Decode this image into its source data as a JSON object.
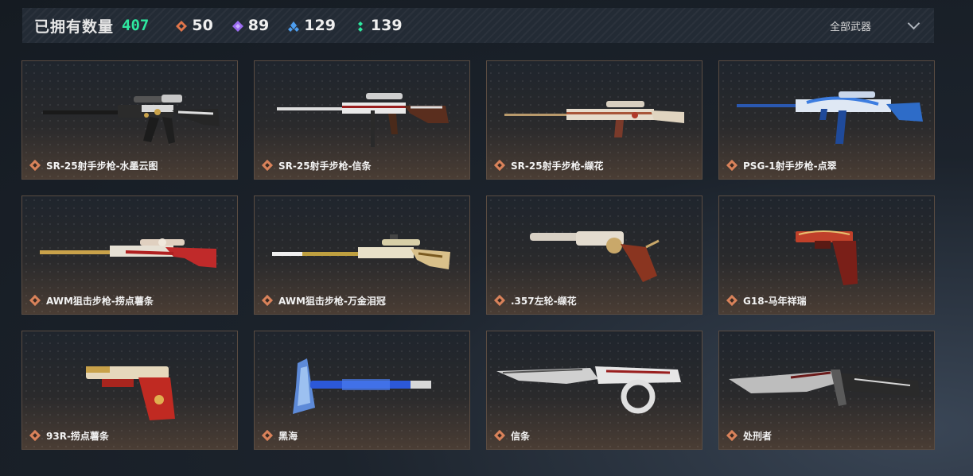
{
  "header": {
    "owned_label": "已拥有数量",
    "owned_count": "407",
    "stats": [
      {
        "icon": "orange-diamond-icon",
        "value": "50",
        "color": "#e0754a"
      },
      {
        "icon": "purple-diamond-icon",
        "value": "89",
        "color": "#9b6cf0"
      },
      {
        "icon": "blue-diamond-icon",
        "value": "129",
        "color": "#4d9ef0"
      },
      {
        "icon": "green-dots-icon",
        "value": "139",
        "color": "#2ee8a0"
      }
    ],
    "filter_label": "全部武器"
  },
  "weapons": [
    {
      "name": "SR-25射手步枪-水墨云图",
      "icon": "sniper-rifle-icon"
    },
    {
      "name": "SR-25射手步枪-信条",
      "icon": "sniper-rifle-icon"
    },
    {
      "name": "SR-25射手步枪-缬花",
      "icon": "sniper-rifle-icon"
    },
    {
      "name": "PSG-1射手步枪-点翠",
      "icon": "sniper-rifle-icon"
    },
    {
      "name": "AWM狙击步枪-捞点薯条",
      "icon": "bolt-sniper-icon"
    },
    {
      "name": "AWM狙击步枪-万金泪冠",
      "icon": "bolt-sniper-icon"
    },
    {
      "name": ".357左轮-缬花",
      "icon": "revolver-icon"
    },
    {
      "name": "G18-马年祥瑞",
      "icon": "pistol-icon"
    },
    {
      "name": "93R-捞点薯条",
      "icon": "pistol-icon"
    },
    {
      "name": "黑海",
      "icon": "axe-icon"
    },
    {
      "name": "信条",
      "icon": "knife-icon"
    },
    {
      "name": "处刑者",
      "icon": "knife-icon"
    }
  ],
  "colors": {
    "accent": "#2ee8a0",
    "rarity": "#d9825a",
    "card_border": "#5a4c42"
  }
}
